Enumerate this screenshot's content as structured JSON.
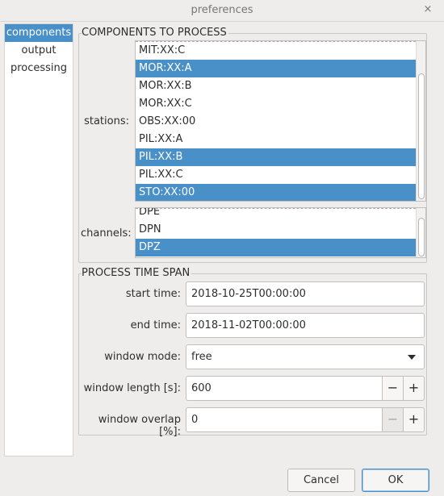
{
  "window": {
    "title": "preferences",
    "close_glyph": "×"
  },
  "sidebar": {
    "items": [
      {
        "label": "components",
        "selected": true
      },
      {
        "label": "output",
        "selected": false
      },
      {
        "label": "processing",
        "selected": false
      }
    ]
  },
  "components": {
    "title": "COMPONENTS TO PROCESS",
    "stations_label": "stations:",
    "stations": [
      {
        "label": "MIT:XX:C",
        "selected": false
      },
      {
        "label": "MOR:XX:A",
        "selected": true
      },
      {
        "label": "MOR:XX:B",
        "selected": false
      },
      {
        "label": "MOR:XX:C",
        "selected": false
      },
      {
        "label": "OBS:XX:00",
        "selected": false
      },
      {
        "label": "PIL:XX:A",
        "selected": false
      },
      {
        "label": "PIL:XX:B",
        "selected": true
      },
      {
        "label": "PIL:XX:C",
        "selected": false
      },
      {
        "label": "STO:XX:00",
        "selected": true
      }
    ],
    "channels_label": "channels:",
    "channels": [
      {
        "label": "DPE",
        "selected": false
      },
      {
        "label": "DPN",
        "selected": false
      },
      {
        "label": "DPZ",
        "selected": true
      }
    ]
  },
  "timespan": {
    "title": "PROCESS TIME SPAN",
    "start_label": "start time:",
    "start_value": "2018-10-25T00:00:00",
    "end_label": "end time:",
    "end_value": "2018-11-02T00:00:00",
    "mode_label": "window mode:",
    "mode_value": "free",
    "length_label": "window length [s]:",
    "length_value": "600",
    "overlap_label": "window overlap [%]:",
    "overlap_value": "0",
    "minus_glyph": "−",
    "plus_glyph": "+"
  },
  "buttons": {
    "cancel": "Cancel",
    "ok": "OK"
  },
  "colors": {
    "selection": "#4a90c8",
    "background": "#eeedeb"
  }
}
